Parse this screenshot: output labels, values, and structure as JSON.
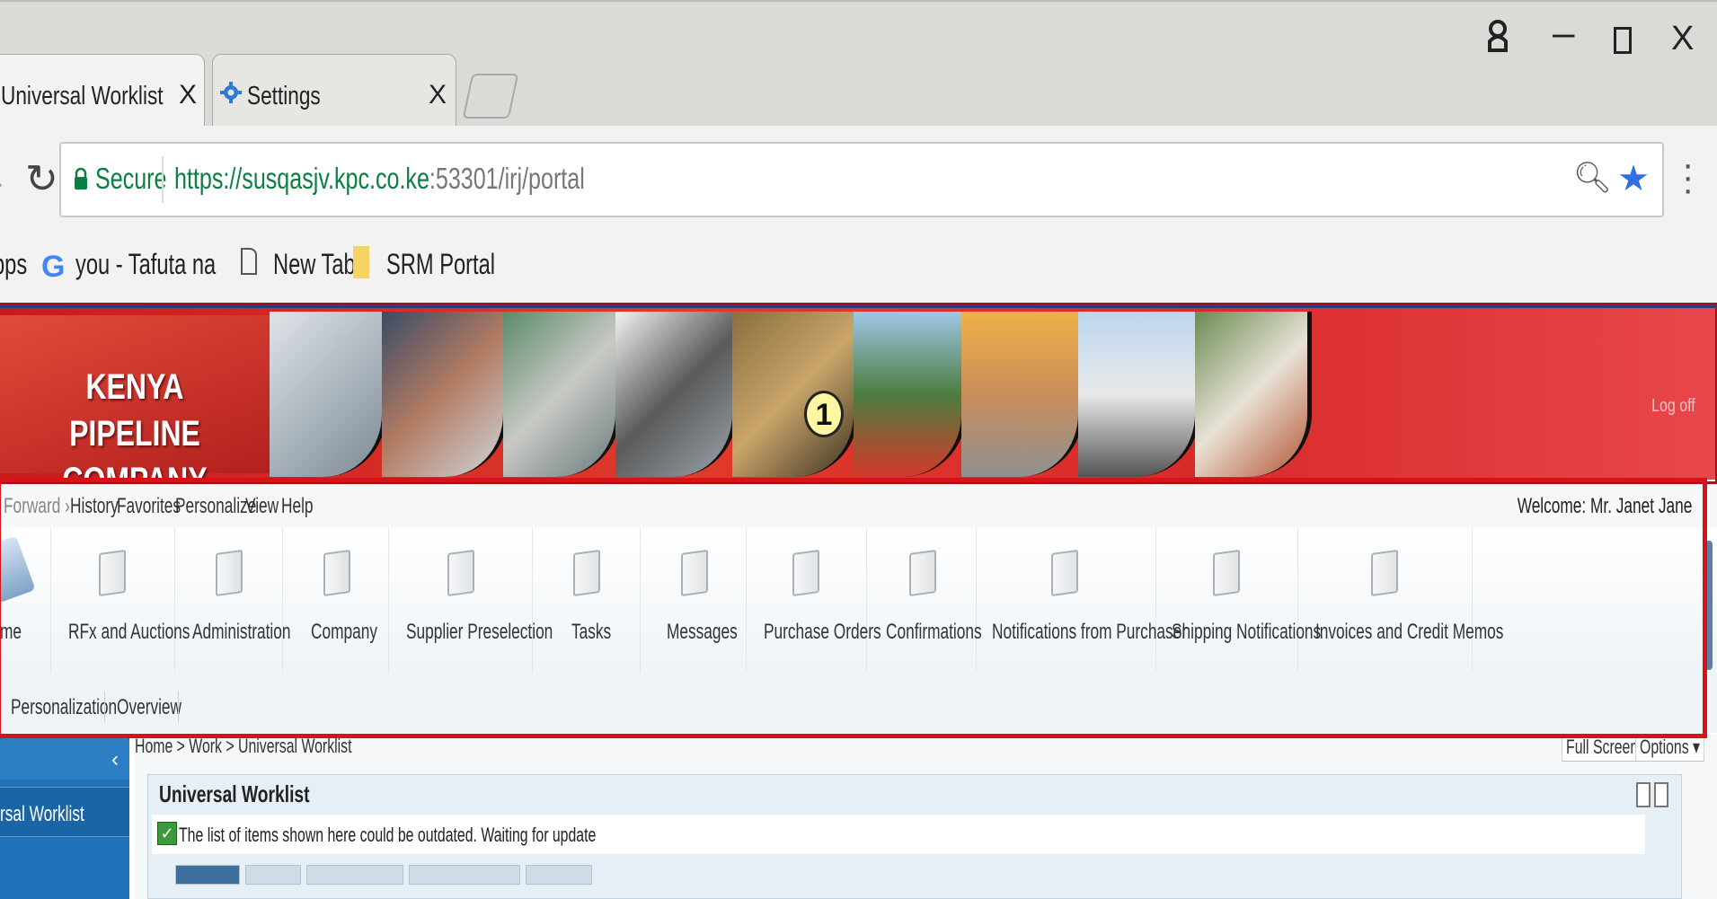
{
  "browser": {
    "tabs": [
      {
        "title": "Universal Worklist - SAP I",
        "close": "X"
      },
      {
        "title": "Settings",
        "close": "X"
      }
    ],
    "window_controls": {
      "minimize": "–",
      "close": "X"
    },
    "address": {
      "secure_label": "Secure",
      "url_host": "https://susqasjv.kpc.co.ke",
      "url_rest": ":53301/irj/portal"
    },
    "bookmarks": [
      "pps",
      "you - Tafuta na Goo",
      "New Tab",
      "SRM Portal"
    ]
  },
  "portal": {
    "company_name_line1": "KENYA PIPELINE",
    "company_name_line2": "COMPANY LTD",
    "callout_number": "1",
    "logoff_label": "Log off",
    "menu": [
      "Forward ›",
      "History",
      "Favorites",
      "Personalize",
      "View",
      "Help"
    ],
    "welcome": "Welcome: Mr. Janet Jane",
    "top_nav": [
      {
        "label": "me"
      },
      {
        "label": "RFx and Auctions"
      },
      {
        "label": "Administration"
      },
      {
        "label": "Company"
      },
      {
        "label": "Supplier Preselection"
      },
      {
        "label": "Tasks"
      },
      {
        "label": "Messages"
      },
      {
        "label": "Purchase Orders"
      },
      {
        "label": "Confirmations"
      },
      {
        "label": "Notifications from Purchaser"
      },
      {
        "label": "Shipping Notifications"
      },
      {
        "label": "Invoices and Credit Memos"
      }
    ],
    "sub_nav": [
      "Personalization",
      "Overview"
    ],
    "detail_nav_item": "rsal Worklist",
    "breadcrumb": "Home  >  Work  >  Universal Worklist",
    "buttons": {
      "full_screen": "Full Screen",
      "options": "Options ▾"
    },
    "worklist": {
      "title": "Universal Worklist",
      "message": "The list of items shown here could be outdated. Waiting for update"
    }
  },
  "colors": {
    "banner_red": "#d92a2a",
    "highlight": "#d6131b",
    "nav_blue": "#1f72b7"
  }
}
